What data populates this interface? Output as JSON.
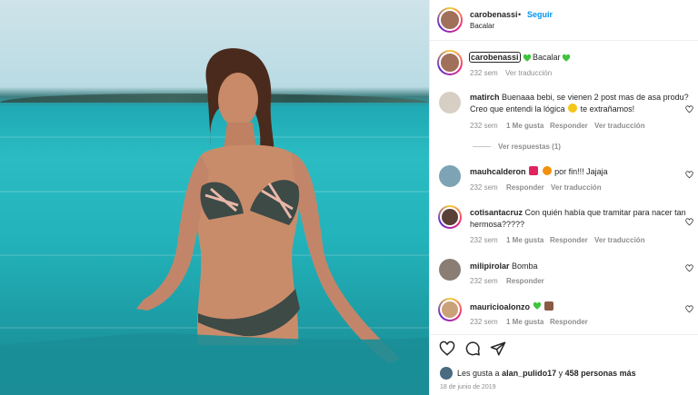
{
  "header": {
    "username": "carobenassi",
    "separator": "•",
    "follow_label": "Seguir",
    "location": "Bacalar"
  },
  "caption": {
    "username": "carobenassi",
    "text": "Bacalar",
    "time": "232 sem",
    "translate": "Ver traducción"
  },
  "comments": [
    {
      "username": "matirch",
      "text_before": "Buenaaa bebi, se vienen 2 post mas de asa produ? Creo que entendi la lógica",
      "text_after": "te extrañamos!",
      "time": "232 sem",
      "likes": "1 Me gusta",
      "reply": "Responder",
      "translate": "Ver traducción",
      "replies": "Ver respuestas (1)"
    },
    {
      "username": "mauhcalderon",
      "text_after": "por fin!!! Jajaja",
      "time": "232 sem",
      "reply": "Responder",
      "translate": "Ver traducción"
    },
    {
      "username": "cotisantacruz",
      "text": "Con quién había que tramitar para nacer tan hermosa?????",
      "time": "232 sem",
      "likes": "1 Me gusta",
      "reply": "Responder",
      "translate": "Ver traducción"
    },
    {
      "username": "milipirolar",
      "text": "Bomba",
      "time": "232 sem",
      "reply": "Responder"
    },
    {
      "username": "mauricioalonzo",
      "time": "232 sem",
      "likes": "1 Me gusta",
      "reply": "Responder"
    }
  ],
  "footer": {
    "likes_prefix": "Les gusta a",
    "liker": "alan_pulido17",
    "likes_mid": "y",
    "likes_count": "458 personas más",
    "date": "18 de junio de 2019"
  },
  "icons": [
    "heart-icon",
    "comment-icon",
    "share-icon"
  ],
  "colors": {
    "accent": "#0095f6",
    "heart": "#ed4956",
    "green_heart": "#3ec43e"
  }
}
